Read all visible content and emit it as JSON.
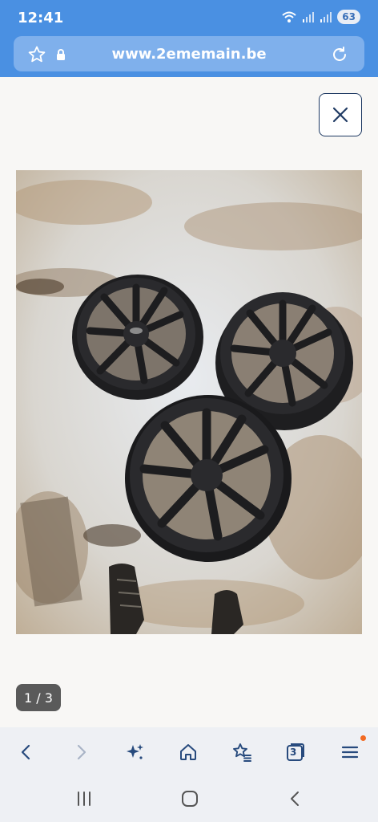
{
  "status": {
    "time": "12:41",
    "battery": "63"
  },
  "browser": {
    "url": "www.2ememain.be"
  },
  "gallery": {
    "counter": "1 / 3",
    "close_label": "Close"
  },
  "toolbar": {
    "tabs_count": "3"
  },
  "colors": {
    "header": "#4a90e2",
    "url_bar": "#7fb0ec",
    "notification_dot": "#f26a22"
  },
  "icons": [
    "star-icon",
    "lock-icon",
    "reload-icon",
    "close-icon",
    "back-icon",
    "forward-icon",
    "sparkle-icon",
    "home-icon",
    "bookmarks-icon",
    "tabs-icon",
    "menu-icon",
    "recent-apps-icon",
    "home-nav-icon",
    "back-nav-icon"
  ]
}
